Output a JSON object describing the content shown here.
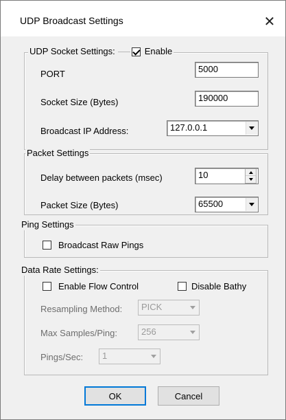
{
  "window": {
    "title": "UDP Broadcast Settings",
    "close_glyph": "✕"
  },
  "udp_socket": {
    "legend": "UDP Socket Settings:",
    "enable_label": "Enable",
    "enable_checked": true,
    "port_label": "PORT",
    "port_value": "5000",
    "socket_size_label": "Socket Size (Bytes)",
    "socket_size_value": "190000",
    "broadcast_ip_label": "Broadcast IP Address:",
    "broadcast_ip_value": "127.0.0.1"
  },
  "packet": {
    "legend": "Packet Settings",
    "delay_label": "Delay between packets (msec)",
    "delay_value": "10",
    "packet_size_label": "Packet Size (Bytes)",
    "packet_size_value": "65500"
  },
  "ping": {
    "legend": "Ping Settings",
    "broadcast_raw_label": "Broadcast Raw Pings",
    "broadcast_raw_checked": false
  },
  "data_rate": {
    "legend": "Data Rate Settings:",
    "flow_control_label": "Enable Flow Control",
    "flow_control_checked": false,
    "disable_bathy_label": "Disable Bathy",
    "disable_bathy_checked": false,
    "resampling_label": "Resampling Method:",
    "resampling_value": "PICK",
    "max_samples_label": "Max Samples/Ping:",
    "max_samples_value": "256",
    "pings_sec_label": "Pings/Sec:",
    "pings_sec_value": "1"
  },
  "buttons": {
    "ok": "OK",
    "cancel": "Cancel"
  }
}
